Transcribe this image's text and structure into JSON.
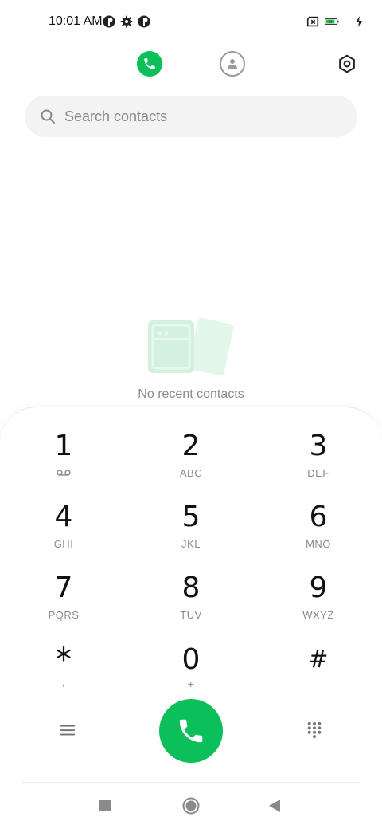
{
  "status_bar": {
    "time": "10:01 AM",
    "battery_level": "83",
    "icons": [
      "app-notification-icon",
      "settings-gear-icon",
      "app-notification-icon",
      "no-sim-icon",
      "battery-icon",
      "charging-bolt-icon"
    ]
  },
  "top_bar": {
    "tabs": [
      {
        "name": "phone-tab",
        "icon": "phone-icon",
        "active": true
      },
      {
        "name": "contacts-tab",
        "icon": "person-icon",
        "active": false
      }
    ],
    "settings_icon": "hexagon-settings-icon"
  },
  "search": {
    "placeholder": "Search contacts",
    "value": ""
  },
  "recents": {
    "empty_text": "No recent contacts"
  },
  "keypad": {
    "keys": [
      {
        "digit": "1",
        "letters": ""
      },
      {
        "digit": "2",
        "letters": "ABC"
      },
      {
        "digit": "3",
        "letters": "DEF"
      },
      {
        "digit": "4",
        "letters": "GHI"
      },
      {
        "digit": "5",
        "letters": "JKL"
      },
      {
        "digit": "6",
        "letters": "MNO"
      },
      {
        "digit": "7",
        "letters": "PQRS"
      },
      {
        "digit": "8",
        "letters": "TUV"
      },
      {
        "digit": "9",
        "letters": "WXYZ"
      },
      {
        "digit": "*",
        "letters": ","
      },
      {
        "digit": "0",
        "letters": "+"
      },
      {
        "digit": "#",
        "letters": ""
      }
    ],
    "key1_icon": "voicemail-icon",
    "bottom_icons": [
      "menu-icon",
      "phone-icon",
      "dialpad-icon"
    ]
  },
  "colors": {
    "accent": "#0bbf5a",
    "secondary_text": "#8a8a8a",
    "battery_fill": "#29c24a"
  },
  "nav_bar": {
    "icons": [
      "recents-square-icon",
      "home-circle-icon",
      "back-triangle-icon"
    ]
  }
}
